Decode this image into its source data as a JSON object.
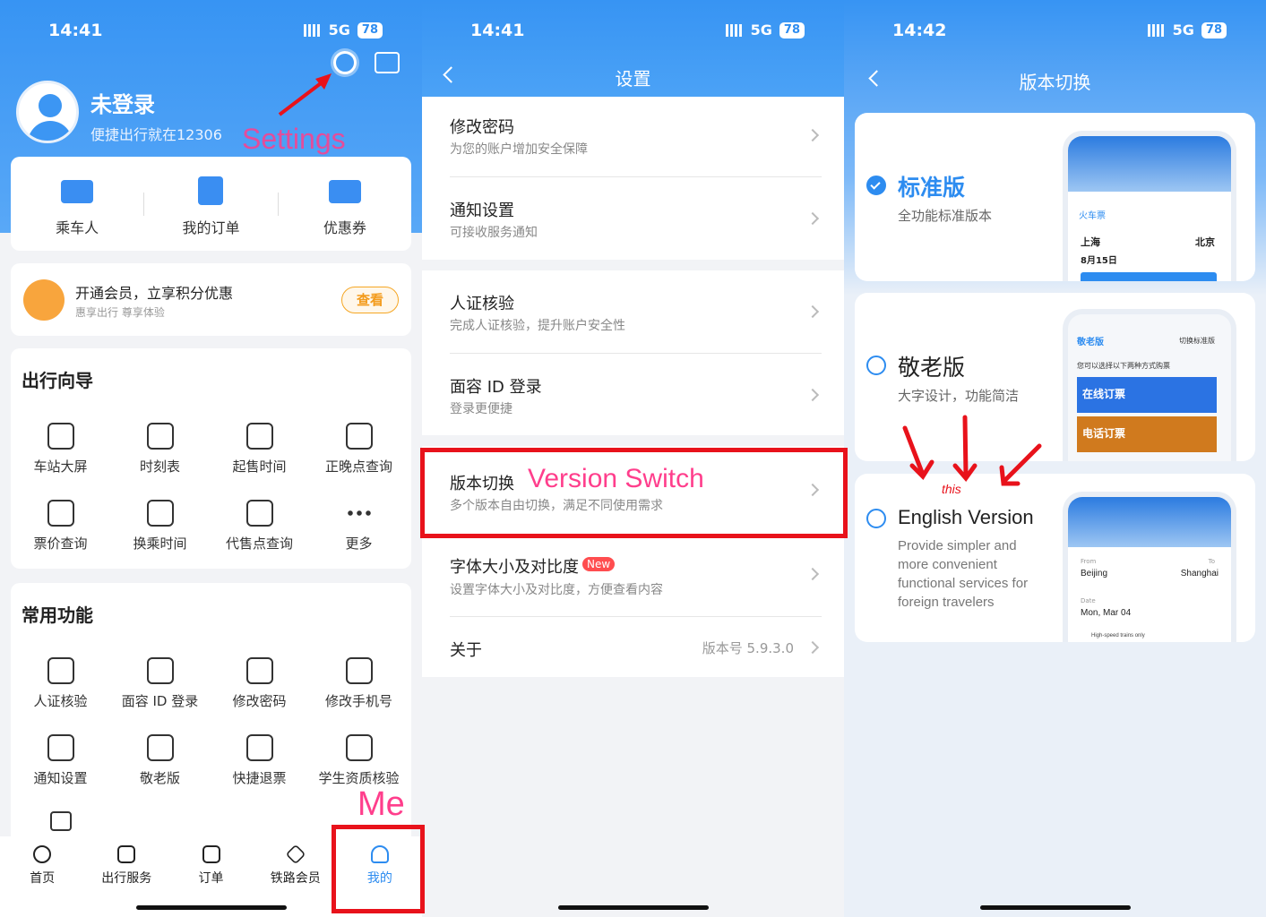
{
  "status": {
    "p1_time": "14:41",
    "p2_time": "14:41",
    "p3_time": "14:42",
    "network": "5G",
    "battery": "78"
  },
  "profile": {
    "name": "未登录",
    "subtitle": "便捷出行就在12306"
  },
  "quick": [
    {
      "label": "乘车人"
    },
    {
      "label": "我的订单"
    },
    {
      "label": "优惠券"
    }
  ],
  "member": {
    "title": "开通会员，立享积分优惠",
    "sub": "惠享出行 尊享体验",
    "btn": "查看"
  },
  "guide": {
    "title": "出行向导",
    "items": [
      "车站大屏",
      "时刻表",
      "起售时间",
      "正晚点查询",
      "票价查询",
      "换乘时间",
      "代售点查询",
      "更多"
    ]
  },
  "common": {
    "title": "常用功能",
    "items": [
      "人证核验",
      "面容 ID 登录",
      "修改密码",
      "修改手机号",
      "通知设置",
      "敬老版",
      "快捷退票",
      "学生资质核验"
    ]
  },
  "tabs": [
    {
      "label": "首页"
    },
    {
      "label": "出行服务"
    },
    {
      "label": "订单"
    },
    {
      "label": "铁路会员"
    },
    {
      "label": "我的"
    }
  ],
  "settings": {
    "title": "设置",
    "rows": [
      {
        "t": "修改密码",
        "s": "为您的账户增加安全保障"
      },
      {
        "t": "通知设置",
        "s": "可接收服务通知"
      },
      {
        "t": "人证核验",
        "s": "完成人证核验，提升账户安全性"
      },
      {
        "t": "面容 ID 登录",
        "s": "登录更便捷"
      },
      {
        "t": "版本切换",
        "s": "多个版本自由切换，满足不同使用需求"
      },
      {
        "t": "字体大小及对比度",
        "s": "设置字体大小及对比度，方便查看内容",
        "badge": "New"
      },
      {
        "t": "关于",
        "value": "版本号 5.9.3.0"
      }
    ]
  },
  "version": {
    "title": "版本切换",
    "options": [
      {
        "name": "标准版",
        "desc": "全功能标准版本",
        "selected": true
      },
      {
        "name": "敬老版",
        "desc": "大字设计，功能简洁",
        "selected": false
      },
      {
        "name": "English Version",
        "desc": "Provide simpler and more convenient functional services for foreign travelers",
        "selected": false
      }
    ],
    "mock1": {
      "tab": "火车票",
      "from": "上海",
      "to": "北京",
      "date": "8月15日"
    },
    "mock2": {
      "brand": "敬老版",
      "switch": "切换标准版",
      "prompt": "您可以选择以下两种方式购票",
      "btn1": "在线订票",
      "btn2": "电话订票"
    },
    "mock3": {
      "from_label": "From",
      "from": "Beijing",
      "to_label": "To",
      "to": "Shanghai",
      "date_label": "Date",
      "date": "Mon, Mar 04",
      "note": "High-speed trains only"
    }
  },
  "annotations": {
    "settings": "Settings",
    "version_switch": "Version Switch",
    "me": "Me",
    "this": "this"
  },
  "colors": {
    "blue": "#2d8cf0",
    "header_blue": "#3a98f5",
    "annotation": "#ff3e8c",
    "highlight": "#e8121b",
    "orange": "#f5a623"
  }
}
